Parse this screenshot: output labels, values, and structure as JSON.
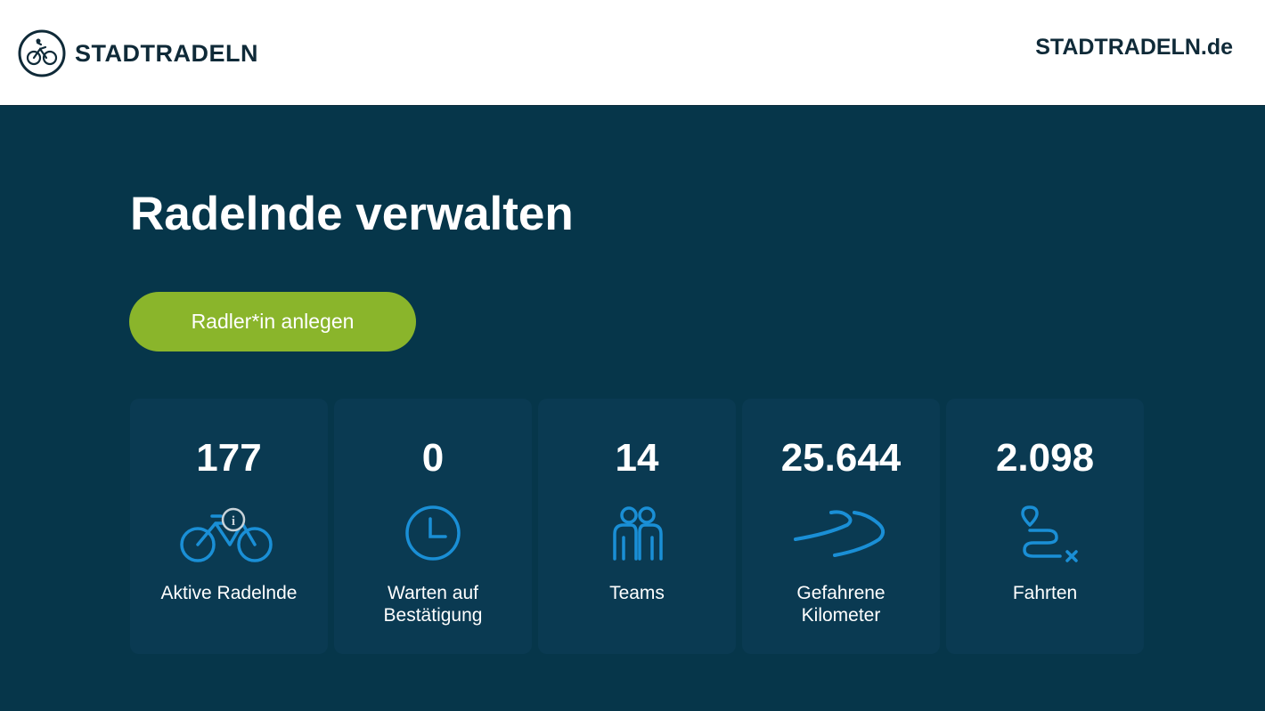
{
  "header": {
    "logo_text": "STADTRADELN",
    "site_link": "STADTRADELN.de"
  },
  "main": {
    "title": "Radelnde verwalten",
    "create_button": "Radler*in anlegen",
    "stats": [
      {
        "value": "177",
        "label": "Aktive Radelnde",
        "icon": "bicycle-icon"
      },
      {
        "value": "0",
        "label": "Warten auf\nBestätigung",
        "icon": "clock-icon"
      },
      {
        "value": "14",
        "label": "Teams",
        "icon": "team-icon"
      },
      {
        "value": "25.644",
        "label": "Gefahrene\nKilometer",
        "icon": "road-icon"
      },
      {
        "value": "2.098",
        "label": "Fahrten",
        "icon": "route-icon"
      }
    ]
  },
  "colors": {
    "background": "#06364a",
    "card": "#0a3a52",
    "accent_green": "#8ab52b",
    "icon_blue": "#1a8fd6"
  }
}
